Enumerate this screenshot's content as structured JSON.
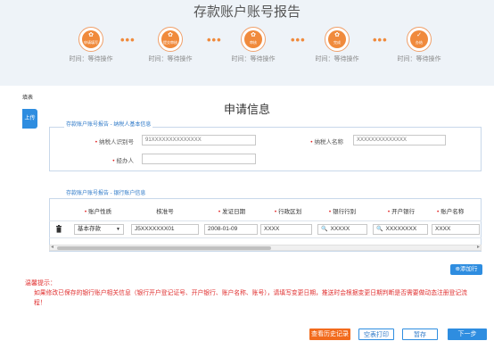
{
  "page": {
    "title": "存款账户账号报告"
  },
  "steps": [
    {
      "icon": "clover-icon",
      "label": "申请填写",
      "caption": "时间：等待操作"
    },
    {
      "icon": "clover-icon",
      "label": "提交审核",
      "caption": "时间：等待操作"
    },
    {
      "icon": "clover-icon",
      "label": "审核",
      "caption": "时间：等待操作"
    },
    {
      "icon": "clover-icon",
      "label": "完成",
      "caption": "时间：等待操作"
    },
    {
      "icon": "check-icon",
      "label": "办结",
      "caption": "时间：等待操作"
    }
  ],
  "side": {
    "header": "填表",
    "tab": "上传"
  },
  "section": {
    "title": "申请信息"
  },
  "taxpayer": {
    "legend": "存款账户账号报告 - 纳税人基本信息",
    "id_label": "纳税人识别号",
    "id_value": "91XXXXXXXXXXXXXX",
    "name_label": "纳税人名称",
    "name_value": "XXXXXXXXXXXXXX",
    "agent_label": "经办人",
    "agent_value": ""
  },
  "bank": {
    "legend": "存款账户账号报告 - 银行账户信息",
    "columns": [
      "账户性质",
      "核准号",
      "发证日期",
      "行政区划",
      "银行行别",
      "开户银行",
      "账户名称"
    ],
    "row": {
      "nature": "基本存款",
      "approval": "J5XXXXXXX01",
      "date": "2008-01-09",
      "region": "XXXX",
      "bank_type": "XXXXX",
      "open_bank": "XXXXXXXX",
      "account_name": "XXXX"
    },
    "add_row": "添加行"
  },
  "tip": {
    "title": "温馨提示：",
    "body": "如果修改已保存的银行账户相关信息（银行开户登记证号、开户银行、账户名称、账号），请填写变更日期，推送时会根据变更日期判断是否需要做动态注册登记流程！"
  },
  "buttons": {
    "history": "查看历史记录",
    "print": "空表打印",
    "save": "暂存",
    "next": "下一步"
  },
  "colors": {
    "accent": "#f08a3c",
    "primary": "#2e8de0",
    "warning": "#e03030"
  }
}
